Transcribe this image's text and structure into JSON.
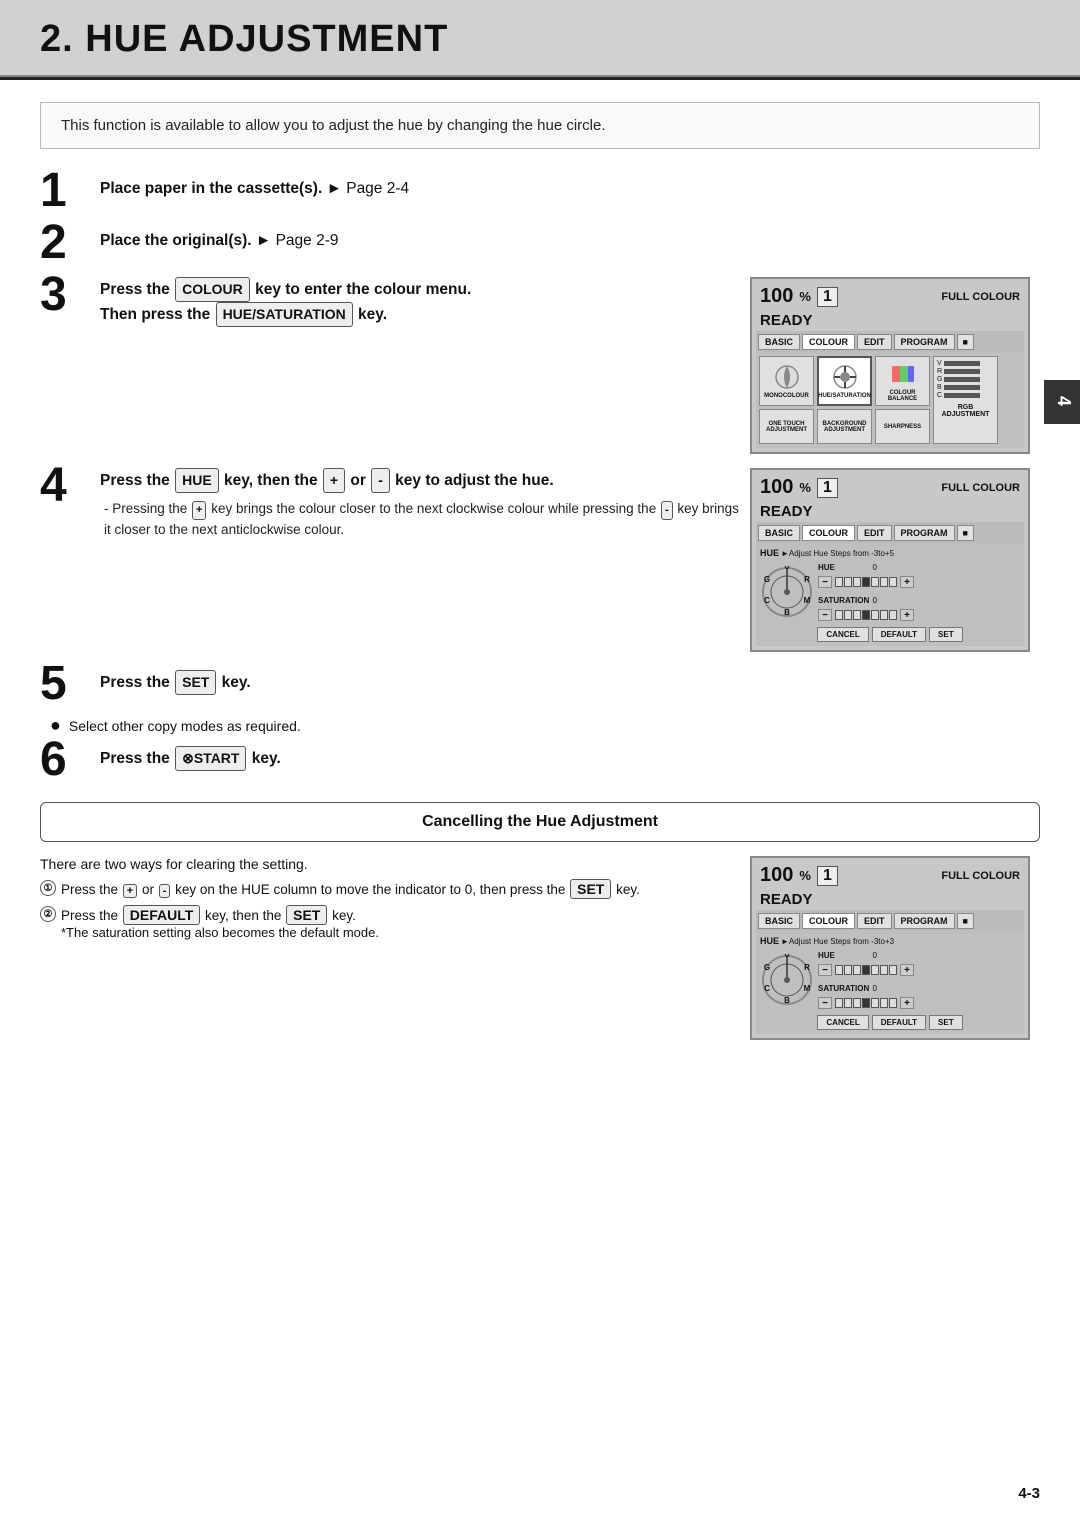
{
  "page": {
    "title": "2. HUE ADJUSTMENT",
    "side_tab": "4",
    "page_number": "4-3"
  },
  "info_box": {
    "text": "This function is available to allow you to adjust the hue by changing the hue circle."
  },
  "steps": [
    {
      "number": "1",
      "text_bold": "Place paper in the cassette(s).",
      "text_after": " ► Page 2-4"
    },
    {
      "number": "2",
      "text_bold": "Place the original(s).",
      "text_after": " ► Page 2-9"
    },
    {
      "number": "3",
      "text_bold_pre": "Press the ",
      "kbd1": "COLOUR",
      "text_mid": " key to enter the colour menu.",
      "text_bold2": "Then press the ",
      "kbd2": "HUE/SATURATION",
      "text_end": " key.",
      "has_screen": true
    },
    {
      "number": "4",
      "text_before": "Press the ",
      "kbd1": "HUE",
      "text_mid": " key, then the ",
      "kbd_plus": "+",
      "text_or": " or ",
      "kbd_minus": "-",
      "text_end": " key to adjust the hue.",
      "sub_note": "- Pressing the (+) key brings the colour closer to the next clockwise colour while pressing the (-) key brings it closer to the next anticlockwise colour.",
      "has_screen": true
    },
    {
      "number": "5",
      "text_before": "Press the ",
      "kbd1": "SET",
      "text_end": " key."
    },
    {
      "number": "6",
      "text_before": "Press the ",
      "kbd1": "⊗START",
      "text_end": " key."
    }
  ],
  "bullet_note": "Select other copy modes as required.",
  "screen3": {
    "pct": "100",
    "pct_sign": "%",
    "num": "1",
    "full_colour": "FULL COLOUR",
    "ready": "READY",
    "tabs": [
      "BASIC",
      "COLOUR",
      "EDIT",
      "PROGRAM"
    ],
    "icons": [
      "MONOCOLOUR",
      "HUE/SATURATION",
      "COLOUR BALANCE",
      "RGB ADJUSTMENT"
    ],
    "bottom_icons": [
      "ONE TOUCH ADJUSTMENT",
      "BACKGROUND ADJUSTMENT",
      "SHARPNESS"
    ]
  },
  "screen4": {
    "pct": "100",
    "pct_sign": "%",
    "num": "1",
    "full_colour": "FULL COLOUR",
    "ready": "READY",
    "tabs": [
      "BASIC",
      "COLOUR",
      "EDIT",
      "PROGRAM"
    ],
    "hue_label": "HUE",
    "adjust_text": "►Adjust Hue Steps from -3to+5",
    "hue_num": "0",
    "saturation_label": "SATURATION",
    "saturation_num": "0",
    "btns": [
      "CANCEL",
      "DEFAULT",
      "SET"
    ]
  },
  "cancel_section": {
    "title": "Cancelling the Hue Adjustment",
    "intro": "There are two ways for clearing the setting.",
    "items": [
      "Press the (+) or (-) key on the HUE column to move the indicator to 0, then press the (SET) key.",
      "Press the (DEFAULT) key, then the (SET) key.\n*The saturation setting also becomes the default mode."
    ]
  },
  "screen_cancel": {
    "pct": "100",
    "pct_sign": "%",
    "num": "1",
    "full_colour": "FULL COLOUR",
    "ready": "READY",
    "tabs": [
      "BASIC",
      "COLOUR",
      "EDIT",
      "PROGRAM"
    ],
    "hue_label": "HUE",
    "adjust_text": "►Adjust Hue Steps from -3to+3",
    "hue_num": "0",
    "saturation_label": "SATURATION",
    "saturation_num": "0",
    "btns": [
      "CANCEL",
      "DEFAULT",
      "SET"
    ]
  }
}
